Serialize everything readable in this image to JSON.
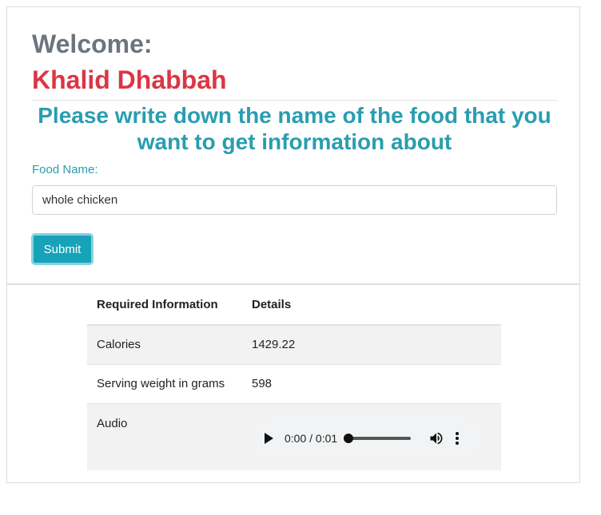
{
  "header": {
    "welcome_label": "Welcome:",
    "user_name": "Khalid Dhabbah"
  },
  "prompt": {
    "text": "Please write down the name of the food that you want to get information about"
  },
  "form": {
    "food_label": "Food Name:",
    "food_value": "whole chicken",
    "submit_label": "Submit"
  },
  "table": {
    "headers": [
      "Required Information",
      "Details"
    ],
    "rows": [
      {
        "label": "Calories",
        "value": "1429.22"
      },
      {
        "label": "Serving weight in grams",
        "value": "598"
      },
      {
        "label": "Audio",
        "value": ""
      }
    ]
  },
  "audio": {
    "time_display": "0:00 / 0:01",
    "progress": 0
  },
  "colors": {
    "welcome": "#6c757d",
    "user_name": "#dc3545",
    "accent": "#17a2b8",
    "prompt": "#2a9db0"
  },
  "icons": [
    "play-icon",
    "volume-icon",
    "more-options-icon"
  ]
}
